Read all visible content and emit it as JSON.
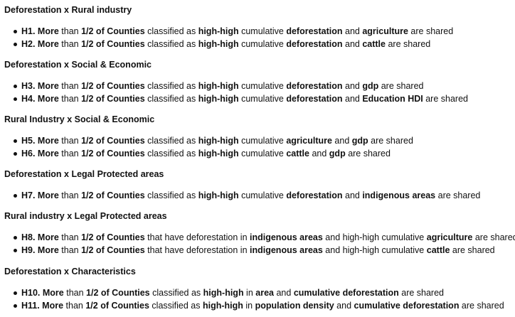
{
  "sections": [
    {
      "title": "Deforestation x Rural industry",
      "items": [
        [
          {
            "t": "H1. More",
            "b": true
          },
          {
            "t": " than ",
            "b": false
          },
          {
            "t": "1/2 of Counties",
            "b": true
          },
          {
            "t": " classified as ",
            "b": false
          },
          {
            "t": "high-high",
            "b": true
          },
          {
            "t": " cumulative ",
            "b": false
          },
          {
            "t": "deforestation",
            "b": true
          },
          {
            "t": " and ",
            "b": false
          },
          {
            "t": "agriculture",
            "b": true
          },
          {
            "t": " are shared",
            "b": false
          }
        ],
        [
          {
            "t": "H2. More",
            "b": true
          },
          {
            "t": " than ",
            "b": false
          },
          {
            "t": "1/2 of Counties",
            "b": true
          },
          {
            "t": " classified as ",
            "b": false
          },
          {
            "t": "high-high",
            "b": true
          },
          {
            "t": " cumulative ",
            "b": false
          },
          {
            "t": "deforestation",
            "b": true
          },
          {
            "t": " and ",
            "b": false
          },
          {
            "t": "cattle",
            "b": true
          },
          {
            "t": " are shared",
            "b": false
          }
        ]
      ]
    },
    {
      "title": "Deforestation x Social & Economic",
      "items": [
        [
          {
            "t": "H3. More",
            "b": true
          },
          {
            "t": " than ",
            "b": false
          },
          {
            "t": "1/2 of Counties",
            "b": true
          },
          {
            "t": " classified as ",
            "b": false
          },
          {
            "t": "high-high",
            "b": true
          },
          {
            "t": " cumulative ",
            "b": false
          },
          {
            "t": "deforestation",
            "b": true
          },
          {
            "t": " and ",
            "b": false
          },
          {
            "t": "gdp",
            "b": true
          },
          {
            "t": " are shared",
            "b": false
          }
        ],
        [
          {
            "t": "H4. More",
            "b": true
          },
          {
            "t": " than ",
            "b": false
          },
          {
            "t": "1/2 of Counties",
            "b": true
          },
          {
            "t": " classified as ",
            "b": false
          },
          {
            "t": "high-high",
            "b": true
          },
          {
            "t": " cumulative ",
            "b": false
          },
          {
            "t": "deforestation",
            "b": true
          },
          {
            "t": " and ",
            "b": false
          },
          {
            "t": "Education HDI",
            "b": true
          },
          {
            "t": " are shared",
            "b": false
          }
        ]
      ]
    },
    {
      "title": "Rural Industry x Social & Economic",
      "items": [
        [
          {
            "t": "H5. More",
            "b": true
          },
          {
            "t": " than ",
            "b": false
          },
          {
            "t": "1/2 of Counties",
            "b": true
          },
          {
            "t": " classified as ",
            "b": false
          },
          {
            "t": "high-high",
            "b": true
          },
          {
            "t": " cumulative ",
            "b": false
          },
          {
            "t": "agriculture",
            "b": true
          },
          {
            "t": " and ",
            "b": false
          },
          {
            "t": "gdp",
            "b": true
          },
          {
            "t": " are shared",
            "b": false
          }
        ],
        [
          {
            "t": "H6. More",
            "b": true
          },
          {
            "t": " than ",
            "b": false
          },
          {
            "t": "1/2 of Counties",
            "b": true
          },
          {
            "t": " classified as ",
            "b": false
          },
          {
            "t": "high-high",
            "b": true
          },
          {
            "t": " cumulative ",
            "b": false
          },
          {
            "t": "cattle",
            "b": true
          },
          {
            "t": " and ",
            "b": false
          },
          {
            "t": "gdp",
            "b": true
          },
          {
            "t": " are shared",
            "b": false
          }
        ]
      ]
    },
    {
      "title": "Deforestation x Legal Protected areas",
      "items": [
        [
          {
            "t": "H7. More",
            "b": true
          },
          {
            "t": " than ",
            "b": false
          },
          {
            "t": "1/2 of Counties",
            "b": true
          },
          {
            "t": " classified as ",
            "b": false
          },
          {
            "t": "high-high",
            "b": true
          },
          {
            "t": " cumulative ",
            "b": false
          },
          {
            "t": "deforestation",
            "b": true
          },
          {
            "t": " and ",
            "b": false
          },
          {
            "t": "indigenous areas",
            "b": true
          },
          {
            "t": " are shared",
            "b": false
          }
        ]
      ]
    },
    {
      "title": "Rural industry x Legal Protected areas",
      "items": [
        [
          {
            "t": "H8. More",
            "b": true
          },
          {
            "t": " than ",
            "b": false
          },
          {
            "t": "1/2 of Counties",
            "b": true
          },
          {
            "t": " that have deforestation in ",
            "b": false
          },
          {
            "t": "indigenous areas",
            "b": true
          },
          {
            "t": " and high-high cumulative ",
            "b": false
          },
          {
            "t": "agriculture",
            "b": true
          },
          {
            "t": " are shared",
            "b": false
          }
        ],
        [
          {
            "t": "H9. More",
            "b": true
          },
          {
            "t": " than ",
            "b": false
          },
          {
            "t": "1/2 of Counties",
            "b": true
          },
          {
            "t": " that have deforestation in ",
            "b": false
          },
          {
            "t": "indigenous areas",
            "b": true
          },
          {
            "t": " and high-high cumulative ",
            "b": false
          },
          {
            "t": "cattle",
            "b": true
          },
          {
            "t": " are shared",
            "b": false
          }
        ]
      ]
    },
    {
      "title": "Deforestation x Characteristics",
      "items": [
        [
          {
            "t": "H10. More",
            "b": true
          },
          {
            "t": " than ",
            "b": false
          },
          {
            "t": "1/2 of Counties",
            "b": true
          },
          {
            "t": " classified as ",
            "b": false
          },
          {
            "t": "high-high",
            "b": true
          },
          {
            "t": " in ",
            "b": false
          },
          {
            "t": "area",
            "b": true
          },
          {
            "t": " and ",
            "b": false
          },
          {
            "t": "cumulative deforestation",
            "b": true
          },
          {
            "t": " are shared",
            "b": false
          }
        ],
        [
          {
            "t": "H11. More",
            "b": true
          },
          {
            "t": " than ",
            "b": false
          },
          {
            "t": "1/2 of Counties",
            "b": true
          },
          {
            "t": " classified as ",
            "b": false
          },
          {
            "t": "high-high",
            "b": true
          },
          {
            "t": " in ",
            "b": false
          },
          {
            "t": "population density",
            "b": true
          },
          {
            "t": " and ",
            "b": false
          },
          {
            "t": "cumulative deforestation",
            "b": true
          },
          {
            "t": " are shared",
            "b": false
          }
        ]
      ]
    }
  ]
}
